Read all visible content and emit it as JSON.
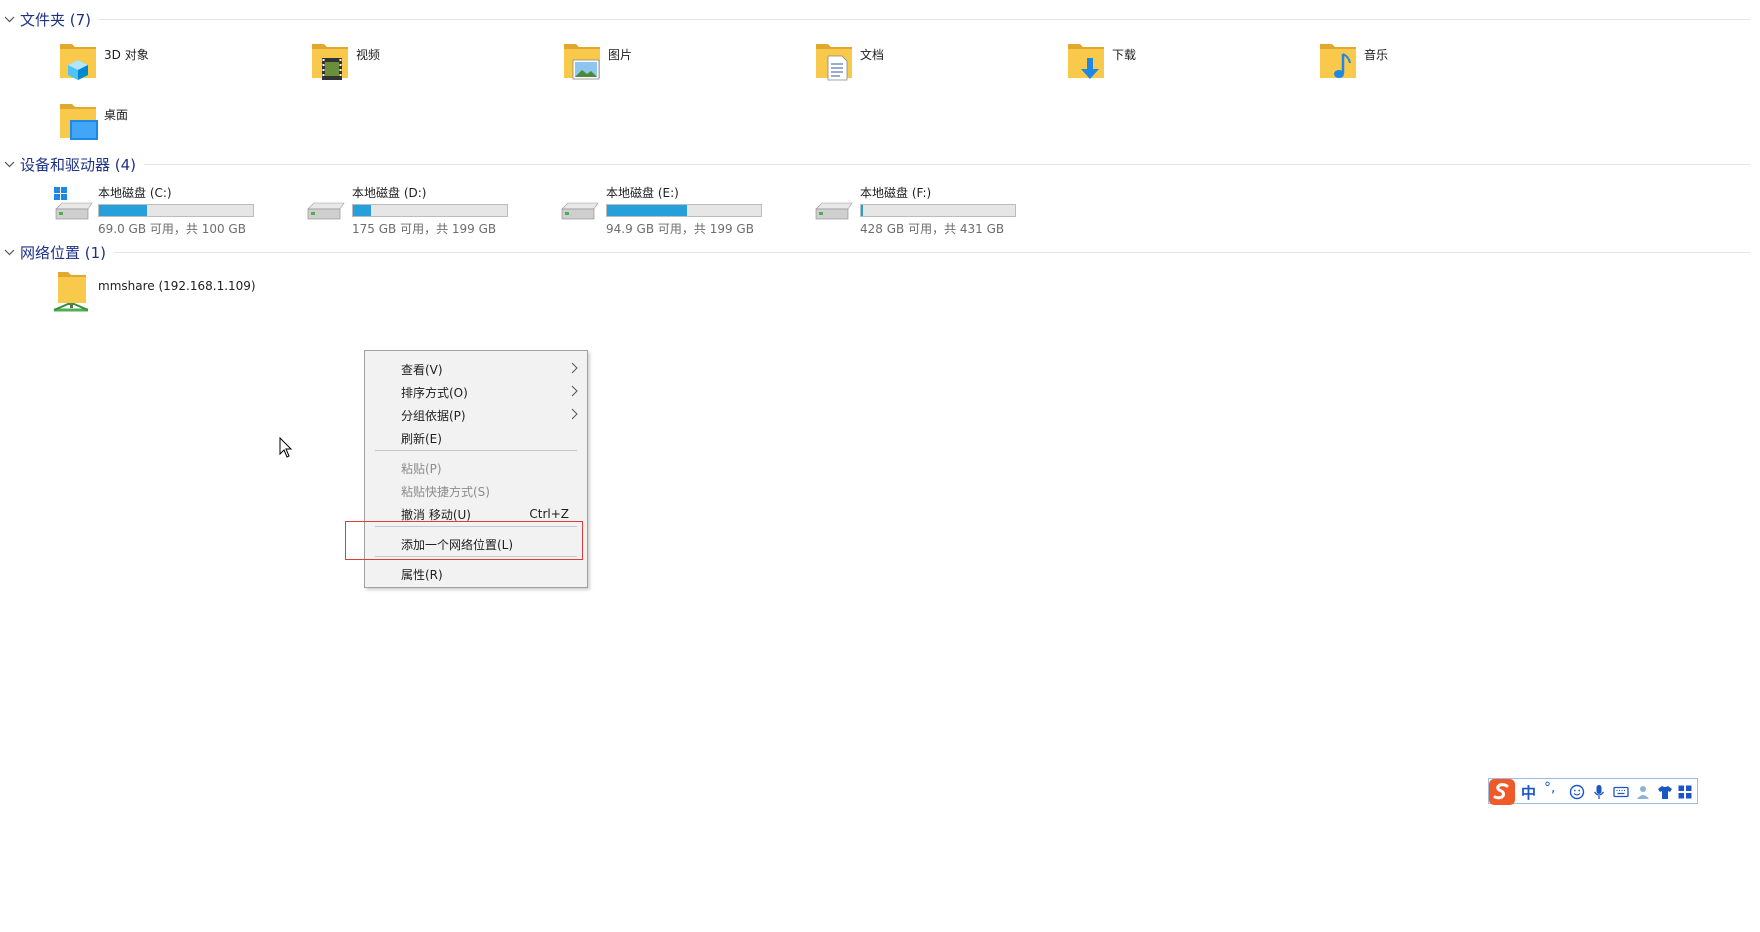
{
  "sections": {
    "folders": {
      "title": "文件夹 (7)"
    },
    "devices": {
      "title": "设备和驱动器 (4)"
    },
    "network": {
      "title": "网络位置 (1)"
    }
  },
  "folders": [
    {
      "label": "3D 对象",
      "icon": "3d-objects-folder-icon"
    },
    {
      "label": "视频",
      "icon": "videos-folder-icon"
    },
    {
      "label": "图片",
      "icon": "pictures-folder-icon"
    },
    {
      "label": "文档",
      "icon": "documents-folder-icon"
    },
    {
      "label": "下载",
      "icon": "downloads-folder-icon"
    },
    {
      "label": "音乐",
      "icon": "music-folder-icon"
    },
    {
      "label": "桌面",
      "icon": "desktop-folder-icon"
    }
  ],
  "drives": [
    {
      "name": "本地磁盘 (C:)",
      "free_text": "69.0 GB 可用，共 100 GB",
      "used_fraction": 0.31,
      "icon": "windows-drive-icon"
    },
    {
      "name": "本地磁盘 (D:)",
      "free_text": "175 GB 可用，共 199 GB",
      "used_fraction": 0.12,
      "icon": "drive-icon"
    },
    {
      "name": "本地磁盘 (E:)",
      "free_text": "94.9 GB 可用，共 199 GB",
      "used_fraction": 0.52,
      "icon": "drive-icon"
    },
    {
      "name": "本地磁盘 (F:)",
      "free_text": "428 GB 可用，共 431 GB",
      "used_fraction": 0.01,
      "icon": "drive-icon"
    }
  ],
  "network_locations": [
    {
      "label": "mmshare (192.168.1.109)",
      "icon": "network-share-icon"
    }
  ],
  "context_menu": {
    "items": [
      {
        "label": "查看(V)",
        "submenu": true,
        "enabled": true
      },
      {
        "label": "排序方式(O)",
        "submenu": true,
        "enabled": true
      },
      {
        "label": "分组依据(P)",
        "submenu": true,
        "enabled": true
      },
      {
        "label": "刷新(E)",
        "enabled": true
      },
      {
        "label": "粘贴(P)",
        "enabled": false
      },
      {
        "label": "粘贴快捷方式(S)",
        "enabled": false
      },
      {
        "label": "撤消 移动(U)",
        "shortcut": "Ctrl+Z",
        "enabled": true
      },
      {
        "label": "添加一个网络位置(L)",
        "enabled": true,
        "highlighted": true
      },
      {
        "label": "属性(R)",
        "enabled": true
      }
    ]
  },
  "ime_toolbar": {
    "mode": "中",
    "punct": "°,",
    "icons": [
      "emoji-icon",
      "microphone-icon",
      "keyboard-icon",
      "user-icon",
      "skin-icon",
      "toolbox-icon"
    ]
  },
  "colors": {
    "section_title": "#1e3287",
    "drive_fill": "#26a0da",
    "highlight_box": "#e03a3a",
    "folder_yellow": "#f8c94a"
  }
}
